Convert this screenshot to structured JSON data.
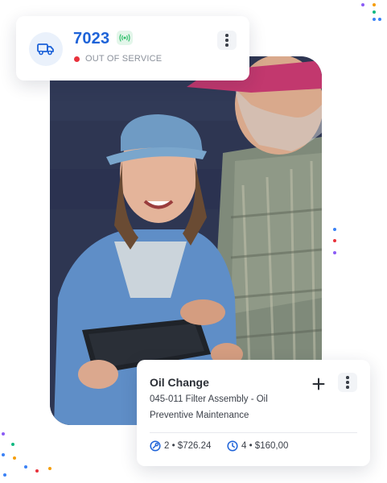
{
  "vehicle_card": {
    "number": "7023",
    "status": "OUT OF SERVICE",
    "status_color": "#e8323c",
    "icon": "truck-icon",
    "signal_icon": "signal-icon"
  },
  "work_order_card": {
    "title": "Oil Change",
    "line1": "045-011 Filter Assembly - Oil",
    "line2": "Preventive Maintenance",
    "parts": "2 • $726.24",
    "labor": "4 • $160,00",
    "parts_icon": "parts-icon",
    "labor_icon": "clock-icon"
  },
  "colors": {
    "accent": "#1e63d8",
    "danger": "#e8323c",
    "success": "#2fbf6a"
  }
}
